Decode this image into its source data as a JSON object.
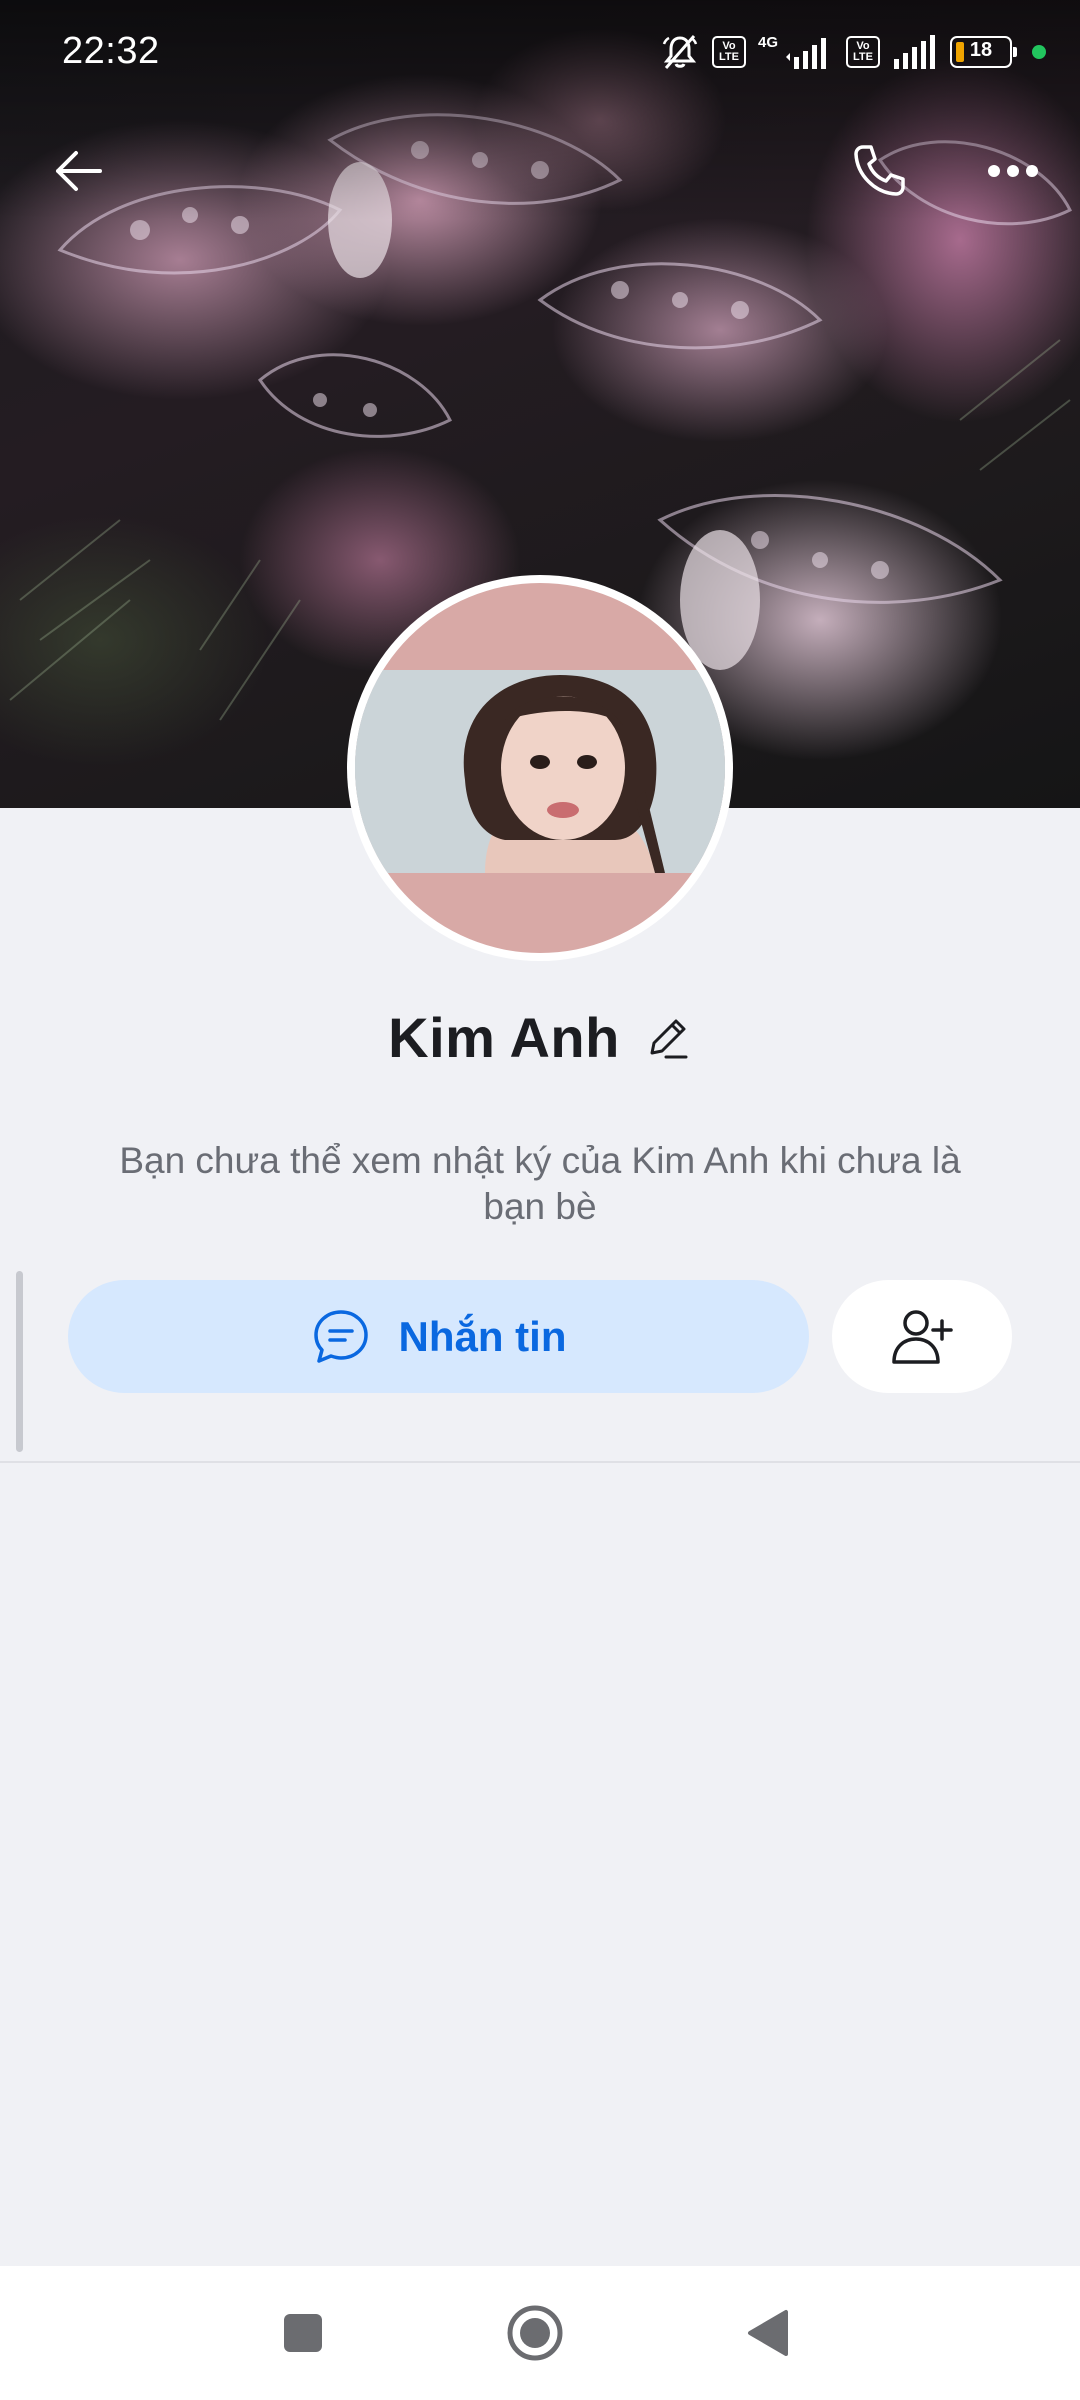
{
  "status_bar": {
    "time": "22:32",
    "network": "4G",
    "volte_top": "Vo",
    "volte_bottom": "LTE",
    "battery_level": "18",
    "icons": [
      "mute-icon",
      "volte-icon",
      "signal-icon",
      "volte-icon",
      "signal-icon",
      "battery-icon",
      "privacy-dot-icon"
    ],
    "battery_fill_color": "#f0a400",
    "privacy_dot_color": "#22c55e"
  },
  "top_bar": {
    "back_icon": "arrow-left-icon",
    "call_icon": "phone-icon",
    "more_icon": "more-horizontal-icon"
  },
  "profile": {
    "name": "Kim Anh",
    "edit_icon": "pencil-icon",
    "notice": "Bạn chưa thể xem nhật ký của Kim Anh khi chưa là bạn bè"
  },
  "actions": {
    "message_label": "Nhắn tin",
    "message_icon": "chat-bubble-icon",
    "add_friend_icon": "add-user-icon",
    "accent_color": "#0a68e0",
    "accent_bg": "#d6e8fe"
  },
  "nav_bar": {
    "recents_icon": "square-icon",
    "home_icon": "circle-icon",
    "back_icon": "triangle-back-icon"
  }
}
